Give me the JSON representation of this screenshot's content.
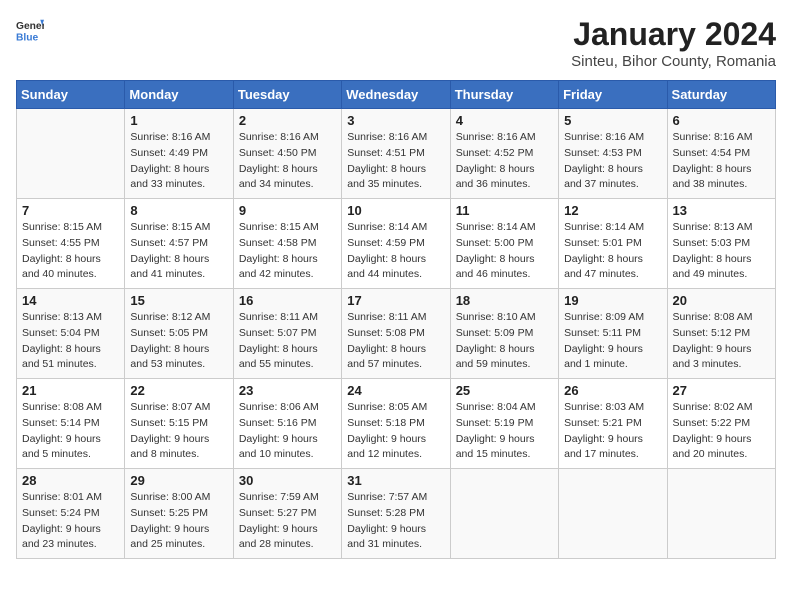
{
  "header": {
    "logo_general": "General",
    "logo_blue": "Blue",
    "month_title": "January 2024",
    "location": "Sinteu, Bihor County, Romania"
  },
  "days_of_week": [
    "Sunday",
    "Monday",
    "Tuesday",
    "Wednesday",
    "Thursday",
    "Friday",
    "Saturday"
  ],
  "weeks": [
    [
      {
        "day": "",
        "sunrise": "",
        "sunset": "",
        "daylight": ""
      },
      {
        "day": "1",
        "sunrise": "Sunrise: 8:16 AM",
        "sunset": "Sunset: 4:49 PM",
        "daylight": "Daylight: 8 hours and 33 minutes."
      },
      {
        "day": "2",
        "sunrise": "Sunrise: 8:16 AM",
        "sunset": "Sunset: 4:50 PM",
        "daylight": "Daylight: 8 hours and 34 minutes."
      },
      {
        "day": "3",
        "sunrise": "Sunrise: 8:16 AM",
        "sunset": "Sunset: 4:51 PM",
        "daylight": "Daylight: 8 hours and 35 minutes."
      },
      {
        "day": "4",
        "sunrise": "Sunrise: 8:16 AM",
        "sunset": "Sunset: 4:52 PM",
        "daylight": "Daylight: 8 hours and 36 minutes."
      },
      {
        "day": "5",
        "sunrise": "Sunrise: 8:16 AM",
        "sunset": "Sunset: 4:53 PM",
        "daylight": "Daylight: 8 hours and 37 minutes."
      },
      {
        "day": "6",
        "sunrise": "Sunrise: 8:16 AM",
        "sunset": "Sunset: 4:54 PM",
        "daylight": "Daylight: 8 hours and 38 minutes."
      }
    ],
    [
      {
        "day": "7",
        "sunrise": "Sunrise: 8:15 AM",
        "sunset": "Sunset: 4:55 PM",
        "daylight": "Daylight: 8 hours and 40 minutes."
      },
      {
        "day": "8",
        "sunrise": "Sunrise: 8:15 AM",
        "sunset": "Sunset: 4:57 PM",
        "daylight": "Daylight: 8 hours and 41 minutes."
      },
      {
        "day": "9",
        "sunrise": "Sunrise: 8:15 AM",
        "sunset": "Sunset: 4:58 PM",
        "daylight": "Daylight: 8 hours and 42 minutes."
      },
      {
        "day": "10",
        "sunrise": "Sunrise: 8:14 AM",
        "sunset": "Sunset: 4:59 PM",
        "daylight": "Daylight: 8 hours and 44 minutes."
      },
      {
        "day": "11",
        "sunrise": "Sunrise: 8:14 AM",
        "sunset": "Sunset: 5:00 PM",
        "daylight": "Daylight: 8 hours and 46 minutes."
      },
      {
        "day": "12",
        "sunrise": "Sunrise: 8:14 AM",
        "sunset": "Sunset: 5:01 PM",
        "daylight": "Daylight: 8 hours and 47 minutes."
      },
      {
        "day": "13",
        "sunrise": "Sunrise: 8:13 AM",
        "sunset": "Sunset: 5:03 PM",
        "daylight": "Daylight: 8 hours and 49 minutes."
      }
    ],
    [
      {
        "day": "14",
        "sunrise": "Sunrise: 8:13 AM",
        "sunset": "Sunset: 5:04 PM",
        "daylight": "Daylight: 8 hours and 51 minutes."
      },
      {
        "day": "15",
        "sunrise": "Sunrise: 8:12 AM",
        "sunset": "Sunset: 5:05 PM",
        "daylight": "Daylight: 8 hours and 53 minutes."
      },
      {
        "day": "16",
        "sunrise": "Sunrise: 8:11 AM",
        "sunset": "Sunset: 5:07 PM",
        "daylight": "Daylight: 8 hours and 55 minutes."
      },
      {
        "day": "17",
        "sunrise": "Sunrise: 8:11 AM",
        "sunset": "Sunset: 5:08 PM",
        "daylight": "Daylight: 8 hours and 57 minutes."
      },
      {
        "day": "18",
        "sunrise": "Sunrise: 8:10 AM",
        "sunset": "Sunset: 5:09 PM",
        "daylight": "Daylight: 8 hours and 59 minutes."
      },
      {
        "day": "19",
        "sunrise": "Sunrise: 8:09 AM",
        "sunset": "Sunset: 5:11 PM",
        "daylight": "Daylight: 9 hours and 1 minute."
      },
      {
        "day": "20",
        "sunrise": "Sunrise: 8:08 AM",
        "sunset": "Sunset: 5:12 PM",
        "daylight": "Daylight: 9 hours and 3 minutes."
      }
    ],
    [
      {
        "day": "21",
        "sunrise": "Sunrise: 8:08 AM",
        "sunset": "Sunset: 5:14 PM",
        "daylight": "Daylight: 9 hours and 5 minutes."
      },
      {
        "day": "22",
        "sunrise": "Sunrise: 8:07 AM",
        "sunset": "Sunset: 5:15 PM",
        "daylight": "Daylight: 9 hours and 8 minutes."
      },
      {
        "day": "23",
        "sunrise": "Sunrise: 8:06 AM",
        "sunset": "Sunset: 5:16 PM",
        "daylight": "Daylight: 9 hours and 10 minutes."
      },
      {
        "day": "24",
        "sunrise": "Sunrise: 8:05 AM",
        "sunset": "Sunset: 5:18 PM",
        "daylight": "Daylight: 9 hours and 12 minutes."
      },
      {
        "day": "25",
        "sunrise": "Sunrise: 8:04 AM",
        "sunset": "Sunset: 5:19 PM",
        "daylight": "Daylight: 9 hours and 15 minutes."
      },
      {
        "day": "26",
        "sunrise": "Sunrise: 8:03 AM",
        "sunset": "Sunset: 5:21 PM",
        "daylight": "Daylight: 9 hours and 17 minutes."
      },
      {
        "day": "27",
        "sunrise": "Sunrise: 8:02 AM",
        "sunset": "Sunset: 5:22 PM",
        "daylight": "Daylight: 9 hours and 20 minutes."
      }
    ],
    [
      {
        "day": "28",
        "sunrise": "Sunrise: 8:01 AM",
        "sunset": "Sunset: 5:24 PM",
        "daylight": "Daylight: 9 hours and 23 minutes."
      },
      {
        "day": "29",
        "sunrise": "Sunrise: 8:00 AM",
        "sunset": "Sunset: 5:25 PM",
        "daylight": "Daylight: 9 hours and 25 minutes."
      },
      {
        "day": "30",
        "sunrise": "Sunrise: 7:59 AM",
        "sunset": "Sunset: 5:27 PM",
        "daylight": "Daylight: 9 hours and 28 minutes."
      },
      {
        "day": "31",
        "sunrise": "Sunrise: 7:57 AM",
        "sunset": "Sunset: 5:28 PM",
        "daylight": "Daylight: 9 hours and 31 minutes."
      },
      {
        "day": "",
        "sunrise": "",
        "sunset": "",
        "daylight": ""
      },
      {
        "day": "",
        "sunrise": "",
        "sunset": "",
        "daylight": ""
      },
      {
        "day": "",
        "sunrise": "",
        "sunset": "",
        "daylight": ""
      }
    ]
  ]
}
